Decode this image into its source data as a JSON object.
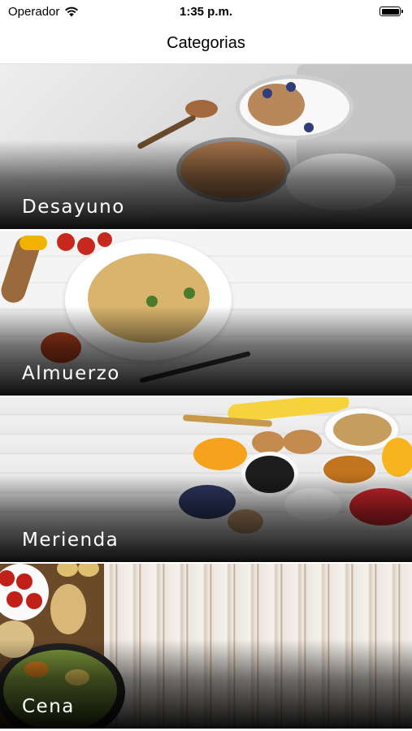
{
  "status_bar": {
    "carrier": "Operador",
    "time": "1:35 p.m.",
    "wifi_icon": "wifi-icon",
    "battery_icon": "battery-icon"
  },
  "header": {
    "title": "Categorias"
  },
  "categories": [
    {
      "label": "Desayuno",
      "image": "breakfast-photo"
    },
    {
      "label": "Almuerzo",
      "image": "lunch-photo"
    },
    {
      "label": "Merienda",
      "image": "snack-photo"
    },
    {
      "label": "Cena",
      "image": "dinner-photo"
    }
  ]
}
